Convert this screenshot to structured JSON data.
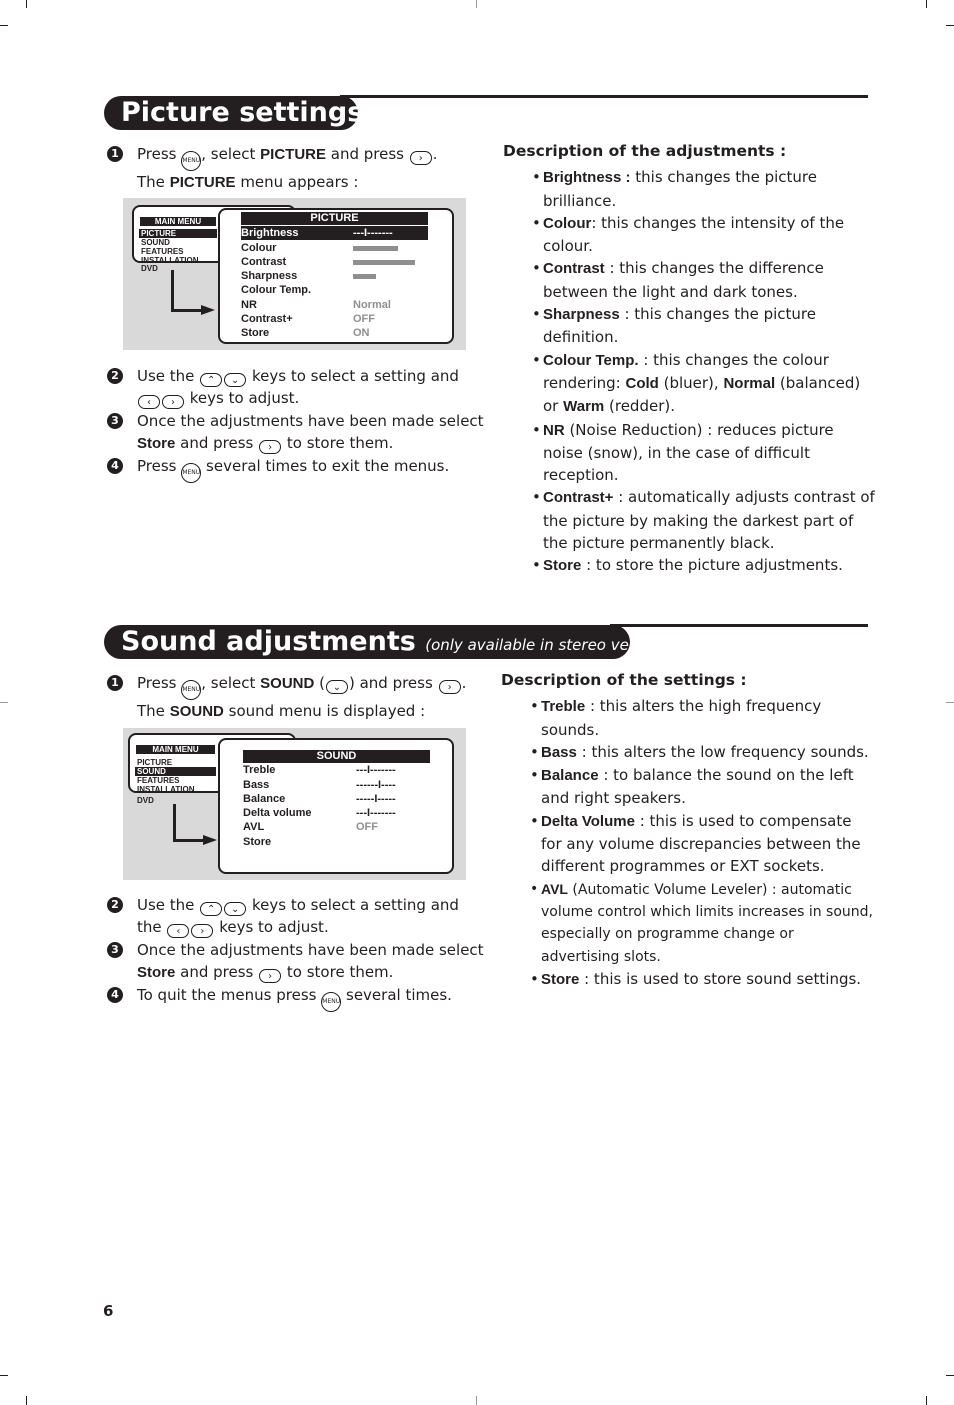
{
  "page_number": "6",
  "picture": {
    "title": "Picture settings",
    "steps": [
      {
        "num": "1",
        "t1": "Press",
        "t2": ", select",
        "b1": "PICTURE",
        "t3": "and press",
        "t4": ".",
        "line2_a": "The",
        "line2_b": "PICTURE",
        "line2_c": "menu appears :"
      },
      {
        "num": "2",
        "t1": "Use the",
        "t2": "keys to select a setting and",
        "t3": "keys to adjust."
      },
      {
        "num": "3",
        "t1": "Once the adjustments have been made select",
        "b1": "Store",
        "t2": "and press",
        "t3": "to store them."
      },
      {
        "num": "4",
        "t1": "Press",
        "t2": "several times to exit the menus."
      }
    ],
    "osd": {
      "main_menu_title": "MAIN MENU",
      "main_menu_items": [
        "PICTURE",
        "SOUND",
        "FEATURES",
        "INSTALLATION",
        "DVD"
      ],
      "selected_main": "PICTURE",
      "submenu_title": "PICTURE",
      "rows": [
        {
          "label": "Brightness",
          "value": "---I-------",
          "selected": true
        },
        {
          "label": "Colour",
          "bar_level": 0.45
        },
        {
          "label": "Contrast",
          "bar_level": 0.62
        },
        {
          "label": "Sharpness",
          "bar_level": 0.23
        },
        {
          "label": "Colour Temp.",
          "value": ""
        },
        {
          "label": "NR",
          "value": "Normal"
        },
        {
          "label": "Contrast+",
          "value": "OFF"
        },
        {
          "label": "Store",
          "value": "ON"
        }
      ]
    },
    "description": {
      "title": "Description of the adjustments :",
      "items": [
        {
          "term": "Brightness :",
          "text": " this changes the picture brilliance."
        },
        {
          "term": "Colour",
          "text": ": this changes the intensity of the colour."
        },
        {
          "term": "Contrast",
          "text": " : this changes the difference between the light and dark tones."
        },
        {
          "term": "Sharpness",
          "text": " : this changes the picture definition."
        },
        {
          "term": "Colour Temp.",
          "text": " : this changes the colour rendering: ",
          "b2": "Cold",
          "t2": " (bluer), ",
          "b3": "Normal",
          "t3": " (balanced) or ",
          "b4": "Warm",
          "t4": " (redder)."
        },
        {
          "term": "NR",
          "text": " (Noise Reduction) : reduces picture noise (snow), in the case of difficult reception."
        },
        {
          "term": "Contrast+",
          "text": " : automatically adjusts contrast of the picture by making the darkest part of the picture permanently black."
        },
        {
          "term": "Store",
          "text": " : to store the picture adjustments."
        }
      ]
    }
  },
  "sound": {
    "title": "Sound adjustments",
    "subtitle": "(only available in stereo versions)",
    "steps": [
      {
        "num": "1",
        "t1": "Press",
        "t2": ", select",
        "b1": "SOUND",
        "t3": "(",
        "t4": ") and press",
        "t5": ".",
        "line2_a": "The",
        "line2_b": "SOUND",
        "line2_c": "sound menu is displayed :"
      },
      {
        "num": "2",
        "t1": "Use the",
        "t2": "keys to select a setting and",
        "t3": "the",
        "t4": "keys to adjust."
      },
      {
        "num": "3",
        "t1": "Once the adjustments have been made select",
        "b1": "Store",
        "t2": "and press",
        "t3": "to store them."
      },
      {
        "num": "4",
        "t1": "To quit the menus press",
        "t2": "several times."
      }
    ],
    "osd": {
      "main_menu_title": "MAIN MENU",
      "main_menu_items": [
        "PICTURE",
        "SOUND",
        "FEATURES",
        "INSTALLATION",
        "DVD"
      ],
      "selected_main": "SOUND",
      "submenu_title": "SOUND",
      "rows": [
        {
          "label": "Treble",
          "value": "---I-------"
        },
        {
          "label": "Bass",
          "value": "------I----"
        },
        {
          "label": "Balance",
          "value": "-----I-----"
        },
        {
          "label": "Delta volume",
          "value": "---I-------"
        },
        {
          "label": "AVL",
          "value": "OFF"
        },
        {
          "label": "Store",
          "value": ""
        }
      ]
    },
    "description": {
      "title": "Description of the settings :",
      "items": [
        {
          "term": "Treble",
          "text": " : this alters the high frequency sounds."
        },
        {
          "term": "Bass",
          "text": " : this alters the low frequency sounds."
        },
        {
          "term": "Balance",
          "text": " : to balance the sound on the left and right speakers."
        },
        {
          "term": "Delta Volume",
          "text": " : this is used to compensate for any volume discrepancies between the different programmes or EXT sockets."
        },
        {
          "term": "AVL",
          "text": " (Automatic Volume Leveler) : automatic volume control which limits increases in sound, especially on programme change or advertising slots."
        },
        {
          "term": "Store",
          "text": " : this is used to store sound settings."
        }
      ]
    }
  },
  "keys": {
    "menu": "MENU",
    "up": "⌃",
    "down": "⌄",
    "left": "‹",
    "right": "›"
  }
}
